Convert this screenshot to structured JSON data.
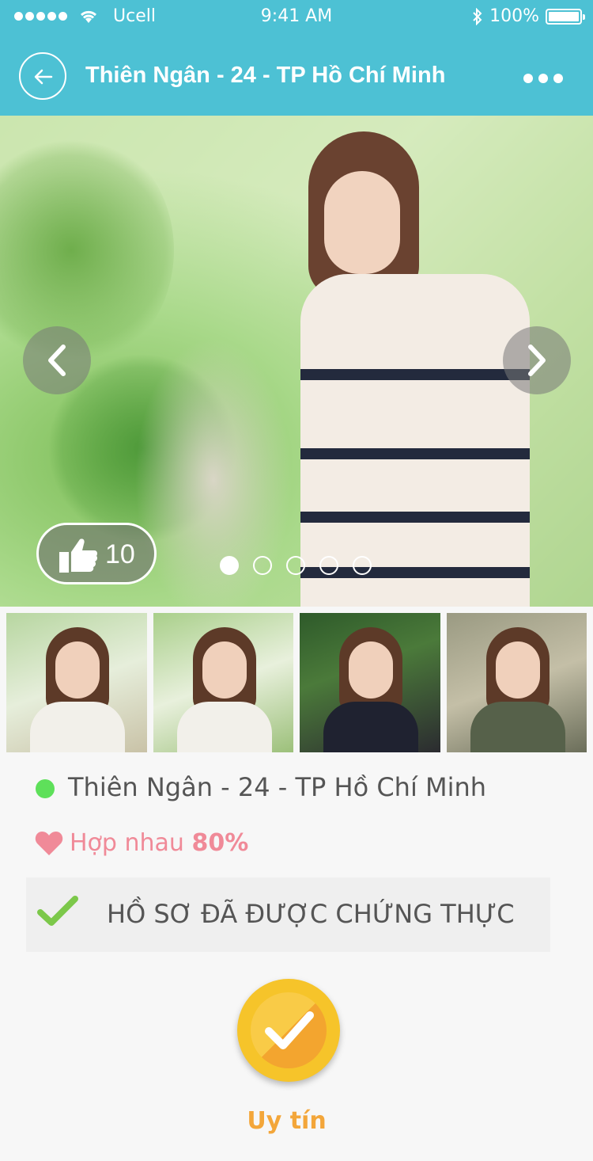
{
  "status_bar": {
    "carrier": "Ucell",
    "time": "9:41 AM",
    "battery": "100%"
  },
  "header": {
    "title": "Thiên Ngân - 24 - TP Hồ Chí Minh",
    "back_icon": "back-arrow-icon",
    "more_icon": "more-dots-icon"
  },
  "gallery": {
    "like_count": "10",
    "current_page": 1,
    "page_count": 5,
    "thumbnail_count": 4
  },
  "profile": {
    "name_line": "Thiên Ngân - 24 - TP Hồ Chí Minh",
    "online": true,
    "match_label": "Hợp nhau",
    "match_percent": "80%",
    "verified_label": "HỒ SƠ ĐÃ ĐƯỢC CHỨNG THỰC",
    "badge_label": "Uy tín"
  },
  "colors": {
    "header_bg": "#4dc1d4",
    "online": "#5ee05a",
    "match": "#f08a98",
    "verified_check": "#7cc84a",
    "badge": "#f6c42a",
    "badge_label": "#f3a63a"
  }
}
